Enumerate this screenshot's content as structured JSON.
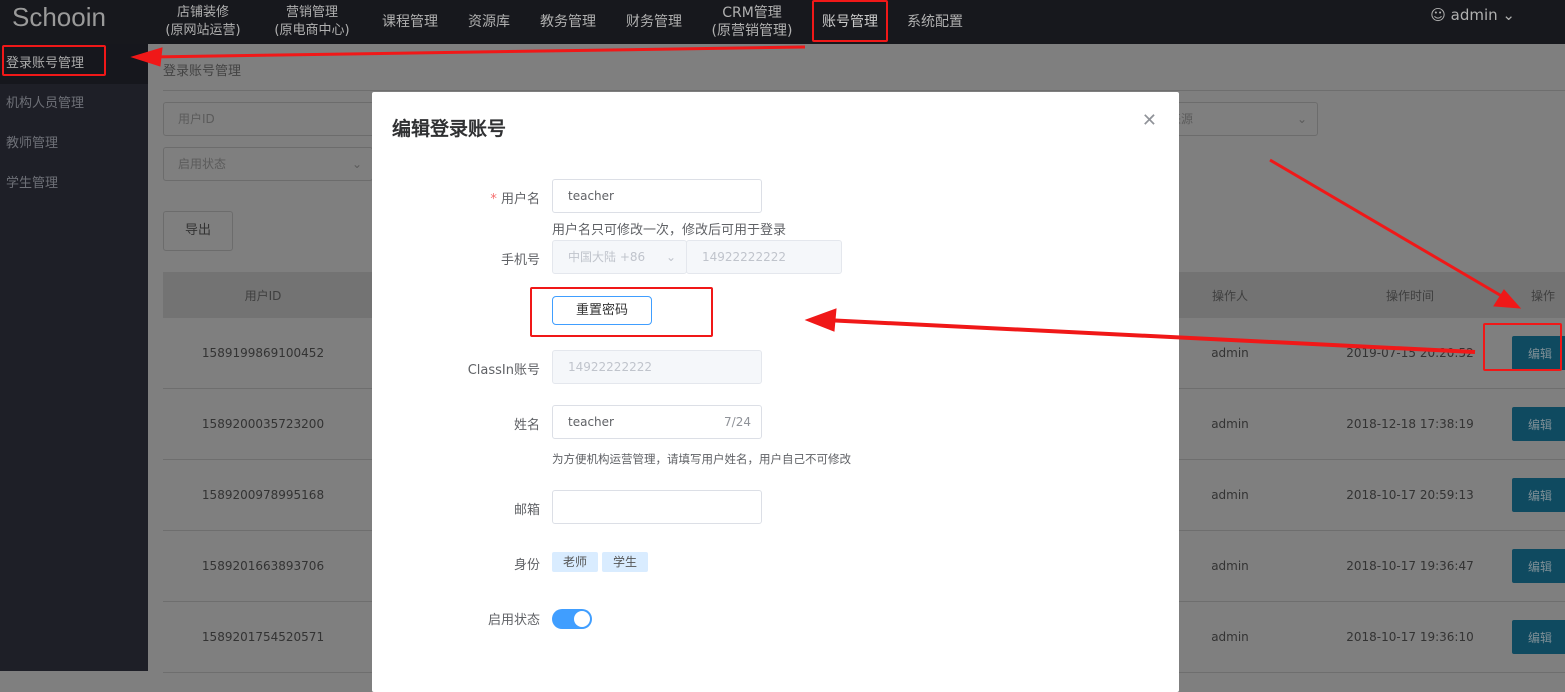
{
  "header": {
    "logo": "Schooin",
    "nav": [
      {
        "line1": "店铺装修",
        "line2": "(原网站运营)"
      },
      {
        "line1": "营销管理",
        "line2": "(原电商中心)"
      },
      {
        "line1": "课程管理"
      },
      {
        "line1": "资源库"
      },
      {
        "line1": "教务管理"
      },
      {
        "line1": "财务管理"
      },
      {
        "line1": "CRM管理",
        "line2": "(原营销管理)"
      },
      {
        "line1": "账号管理"
      },
      {
        "line1": "系统配置"
      }
    ],
    "user": "admin",
    "user_icon": "user-icon"
  },
  "sidebar": {
    "items": [
      {
        "label": "登录账号管理",
        "active": true
      },
      {
        "label": "机构人员管理"
      },
      {
        "label": "教师管理"
      },
      {
        "label": "学生管理"
      }
    ]
  },
  "main": {
    "breadcrumb": "登录账号管理",
    "filters": {
      "user_id_placeholder": "用户ID",
      "status_placeholder": "启用状态",
      "source_placeholder": "来源"
    },
    "export_label": "导出",
    "table": {
      "headers": {
        "user_id": "用户ID",
        "operator": "操作人",
        "time": "操作时间",
        "action": "操作"
      },
      "rows": [
        {
          "user_id": "1589199869100452",
          "operator": "admin",
          "time": "2019-07-15 20:20:52",
          "action": "编辑"
        },
        {
          "user_id": "1589200035723200",
          "operator": "admin",
          "time": "2018-12-18 17:38:19",
          "action": "编辑"
        },
        {
          "user_id": "1589200978995168",
          "operator": "admin",
          "time": "2018-10-17 20:59:13",
          "action": "编辑"
        },
        {
          "user_id": "1589201663893706",
          "operator": "admin",
          "time": "2018-10-17 19:36:47",
          "action": "编辑"
        },
        {
          "user_id": "1589201754520571",
          "operator": "admin",
          "time": "2018-10-17 19:36:10",
          "action": "编辑"
        }
      ]
    }
  },
  "modal": {
    "title": "编辑登录账号",
    "close_icon": "close-icon",
    "username": {
      "label": "用户名",
      "required": "*",
      "value": "teacher",
      "hint": "用户名只可修改一次，修改后可用于登录"
    },
    "phone": {
      "label": "手机号",
      "country": "中国大陆 +86",
      "value": "14922222222"
    },
    "reset_password": "重置密码",
    "classin": {
      "label": "ClassIn账号",
      "value": "14922222222"
    },
    "name": {
      "label": "姓名",
      "value": "teacher",
      "count": "7/24",
      "hint": "为方便机构运营管理，请填写用户姓名，用户自己不可修改"
    },
    "email": {
      "label": "邮箱",
      "value": ""
    },
    "identity": {
      "label": "身份",
      "tags": [
        "老师",
        "学生"
      ]
    },
    "status": {
      "label": "启用状态",
      "enabled": true
    }
  },
  "annotation_color": "#f01818"
}
